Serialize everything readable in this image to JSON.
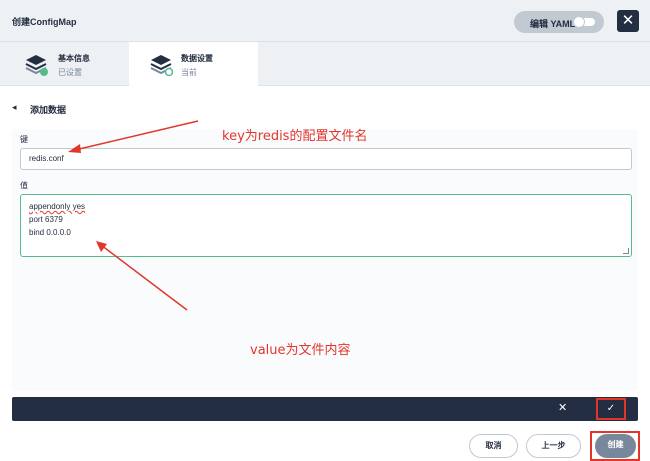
{
  "header": {
    "title": "创建ConfigMap",
    "yaml_label": "编辑 YAML",
    "close_glyph": "✕"
  },
  "steps": [
    {
      "title": "基本信息",
      "status": "已设置"
    },
    {
      "title": "数据设置",
      "status": "当前"
    }
  ],
  "section": {
    "back_glyph": "◂",
    "title": "添加数据"
  },
  "form": {
    "key_label": "键",
    "key_value": "redis.conf",
    "value_label": "值",
    "value_lines": [
      "appendonly yes",
      "port 6379",
      "bind 0.0.0.0"
    ]
  },
  "annotations": {
    "key_note": "key为redis的配置文件名",
    "value_note": "value为文件内容"
  },
  "action_bar": {
    "cancel_glyph": "✕",
    "confirm_glyph": "✓"
  },
  "footer": {
    "cancel_label": "取消",
    "prev_label": "上一步",
    "create_label": "创建"
  },
  "colors": {
    "accent_green": "#55bc8a",
    "annotation_red": "#e2362b",
    "dark": "#242e42"
  }
}
